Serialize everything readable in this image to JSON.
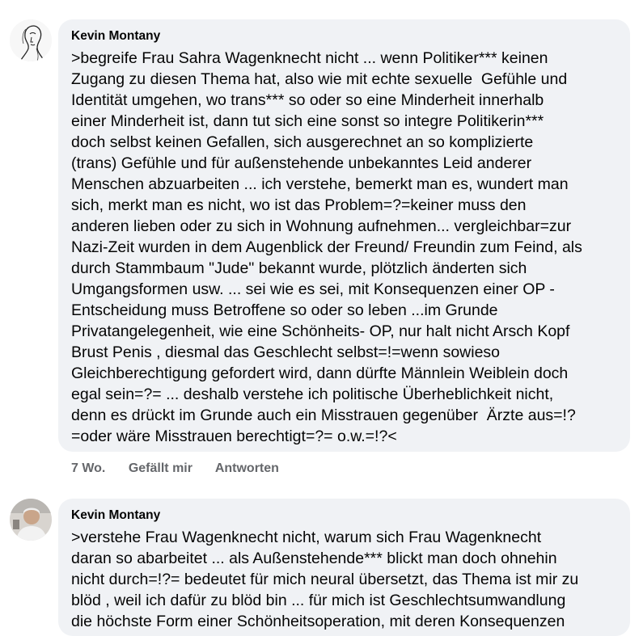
{
  "comments": [
    {
      "author": "Kevin Montany",
      "text": ">begreife Frau Sahra Wagenknecht nicht ... wenn Politiker*** keinen\nZugang zu diesen Thema hat, also wie mit echte sexuelle  Gefühle und\nIdentität umgehen, wo trans*** so oder so eine Minderheit innerhalb\neiner Minderheit ist, dann tut sich eine sonst so integre Politikerin***\ndoch selbst keinen Gefallen, sich ausgerechnet an so komplizierte\n(trans) Gefühle und für außenstehende unbekanntes Leid anderer\nMenschen abzuarbeiten ... ich verstehe, bemerkt man es, wundert man\nsich, merkt man es nicht, wo ist das Problem=?=keiner muss den\nanderen lieben oder zu sich in Wohnung aufnehmen... vergleichbar=zur\nNazi-Zeit wurden in dem Augenblick der Freund/ Freundin zum Feind, als\ndurch Stammbaum \"Jude\" bekannt wurde, plötzlich änderten sich\nUmgangsformen usw. ... sei wie es sei, mit Konsequenzen einer OP -\nEntscheidung muss Betroffene so oder so leben ...im Grunde\nPrivatangelegenheit, wie eine Schönheits- OP, nur halt nicht Arsch Kopf\nBrust Penis , diesmal das Geschlecht selbst=!=wenn sowieso\nGleichberechtigung gefordert wird, dann dürfte Männlein Weiblein doch\negal sein=?= ... deshalb verstehe ich politische Überheblichkeit nicht,\ndenn es drückt im Grunde auch ein Misstrauen gegenüber  Ärzte aus=!?\n=oder wäre Misstrauen berechtigt=?= o.w.=!?<",
      "timestamp": "7 Wo.",
      "like_label": "Gefällt mir",
      "reply_label": "Antworten"
    },
    {
      "author": "Kevin Montany",
      "text": ">verstehe Frau Wagenknecht nicht, warum sich Frau Wagenknecht\ndaran so abarbeitet ... als Außenstehende*** blickt man doch ohnehin\nnicht durch=!?= bedeutet für mich neural übersetzt, das Thema ist mir zu\nblöd , weil ich dafür zu blöd bin ... für mich ist Geschlechtsumwandlung\ndie höchste Form einer Schönheitsoperation, mit deren Konsequenzen"
    }
  ]
}
